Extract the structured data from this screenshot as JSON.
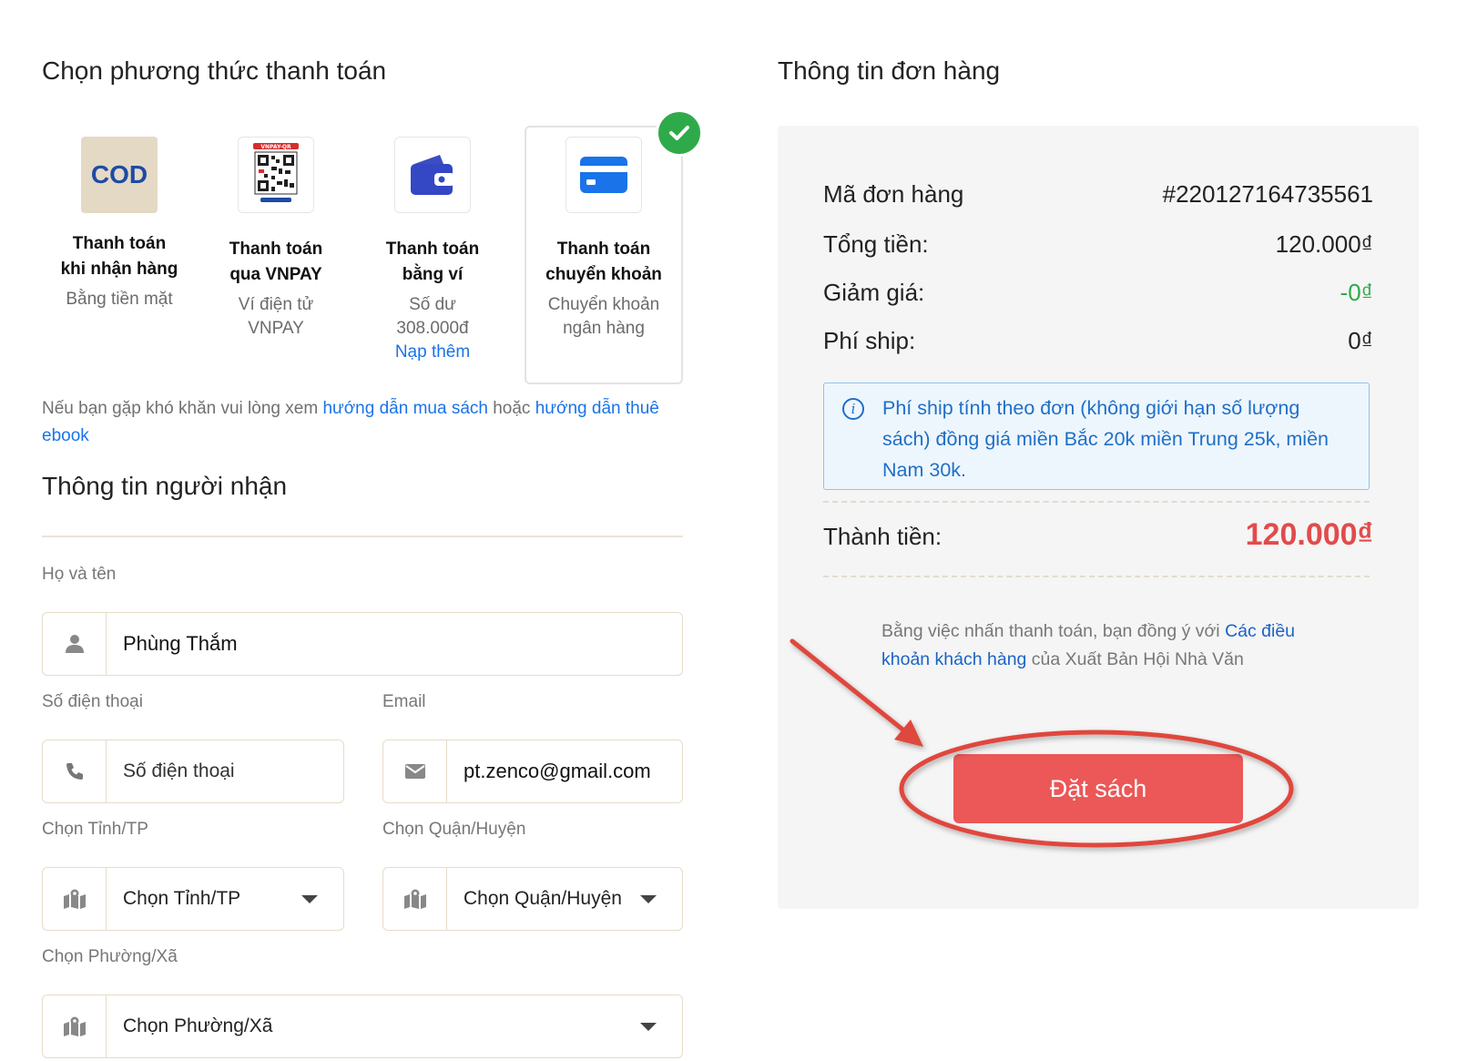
{
  "payment": {
    "title": "Chọn phương thức thanh toán",
    "options": [
      {
        "icon_text": "COD",
        "name_line1": "Thanh toán",
        "name_line2": "khi nhận hàng",
        "desc_line1": "Bằng tiền mặt",
        "desc_line2": ""
      },
      {
        "icon_text": "VNPAY-QR",
        "name_line1": "Thanh toán",
        "name_line2": "qua VNPAY",
        "desc_line1": "Ví điện tử",
        "desc_line2": "VNPAY"
      },
      {
        "name_line1": "Thanh toán",
        "name_line2": "bằng ví",
        "desc_line1": "Số dư",
        "desc_line2": "308.000đ",
        "link": "Nạp thêm"
      },
      {
        "name_line1": "Thanh toán",
        "name_line2": "chuyển khoản",
        "desc_line1": "Chuyển khoản",
        "desc_line2": "ngân hàng",
        "selected": true
      }
    ],
    "help": {
      "prefix": "Nếu bạn gặp khó khăn vui lòng xem ",
      "link1": "hướng dẫn mua sách",
      "middle": " hoặc ",
      "link2": "hướng dẫn thuê ebook"
    }
  },
  "recipient": {
    "title": "Thông tin người nhận",
    "name_label": "Họ và tên",
    "name_value": "Phùng Thắm",
    "phone_label": "Số điện thoại",
    "phone_placeholder": "Số điện thoại",
    "email_label": "Email",
    "email_value": "pt.zenco@gmail.com",
    "province_label": "Chọn Tỉnh/TP",
    "province_value": "Chọn Tỉnh/TP",
    "district_label": "Chọn Quận/Huyện",
    "district_value": "Chọn Quận/Huyện",
    "ward_label": "Chọn Phường/Xã",
    "ward_value": "Chọn Phường/Xã"
  },
  "order": {
    "title": "Thông tin đơn hàng",
    "order_id_label": "Mã đơn hàng",
    "order_id": "#220127164735561",
    "total_label": "Tổng tiền:",
    "total": "120.000₫",
    "discount_label": "Giảm giá:",
    "discount": "-0₫",
    "ship_label": "Phí ship:",
    "ship": "0₫",
    "ship_info": "Phí ship tính theo đơn (không giới hạn số lượng sách) đồng giá miền Bắc 20k miền Trung 25k, miền Nam 30k.",
    "final_label": "Thành tiền:",
    "final": "120.000₫",
    "terms_prefix": "Bằng việc nhấn thanh toán, bạn đồng ý với ",
    "terms_link": "Các điều khoản khách hàng",
    "terms_suffix": " của Xuất Bản Hội Nhà Văn",
    "submit_label": "Đặt sách"
  },
  "colors": {
    "accent_blue": "#1a73e8",
    "success_green": "#2faa4a",
    "price_red": "#e24b4b",
    "button_red": "#ec5757",
    "annotation_red": "#e0463c"
  },
  "icons": [
    "cod-icon",
    "vnpay-qr-icon",
    "wallet-icon",
    "credit-card-icon",
    "check-icon",
    "user-icon",
    "phone-icon",
    "envelope-icon",
    "map-icon",
    "info-icon",
    "chevron-down-icon"
  ]
}
